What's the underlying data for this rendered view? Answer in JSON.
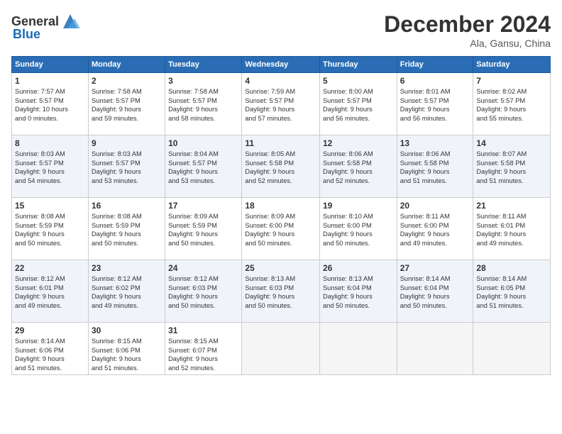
{
  "header": {
    "logo_general": "General",
    "logo_blue": "Blue",
    "month_title": "December 2024",
    "location": "Ala, Gansu, China"
  },
  "days_of_week": [
    "Sunday",
    "Monday",
    "Tuesday",
    "Wednesday",
    "Thursday",
    "Friday",
    "Saturday"
  ],
  "weeks": [
    [
      {
        "day": "1",
        "info": "Sunrise: 7:57 AM\nSunset: 5:57 PM\nDaylight: 10 hours\nand 0 minutes."
      },
      {
        "day": "2",
        "info": "Sunrise: 7:58 AM\nSunset: 5:57 PM\nDaylight: 9 hours\nand 59 minutes."
      },
      {
        "day": "3",
        "info": "Sunrise: 7:58 AM\nSunset: 5:57 PM\nDaylight: 9 hours\nand 58 minutes."
      },
      {
        "day": "4",
        "info": "Sunrise: 7:59 AM\nSunset: 5:57 PM\nDaylight: 9 hours\nand 57 minutes."
      },
      {
        "day": "5",
        "info": "Sunrise: 8:00 AM\nSunset: 5:57 PM\nDaylight: 9 hours\nand 56 minutes."
      },
      {
        "day": "6",
        "info": "Sunrise: 8:01 AM\nSunset: 5:57 PM\nDaylight: 9 hours\nand 56 minutes."
      },
      {
        "day": "7",
        "info": "Sunrise: 8:02 AM\nSunset: 5:57 PM\nDaylight: 9 hours\nand 55 minutes."
      }
    ],
    [
      {
        "day": "8",
        "info": "Sunrise: 8:03 AM\nSunset: 5:57 PM\nDaylight: 9 hours\nand 54 minutes."
      },
      {
        "day": "9",
        "info": "Sunrise: 8:03 AM\nSunset: 5:57 PM\nDaylight: 9 hours\nand 53 minutes."
      },
      {
        "day": "10",
        "info": "Sunrise: 8:04 AM\nSunset: 5:57 PM\nDaylight: 9 hours\nand 53 minutes."
      },
      {
        "day": "11",
        "info": "Sunrise: 8:05 AM\nSunset: 5:58 PM\nDaylight: 9 hours\nand 52 minutes."
      },
      {
        "day": "12",
        "info": "Sunrise: 8:06 AM\nSunset: 5:58 PM\nDaylight: 9 hours\nand 52 minutes."
      },
      {
        "day": "13",
        "info": "Sunrise: 8:06 AM\nSunset: 5:58 PM\nDaylight: 9 hours\nand 51 minutes."
      },
      {
        "day": "14",
        "info": "Sunrise: 8:07 AM\nSunset: 5:58 PM\nDaylight: 9 hours\nand 51 minutes."
      }
    ],
    [
      {
        "day": "15",
        "info": "Sunrise: 8:08 AM\nSunset: 5:59 PM\nDaylight: 9 hours\nand 50 minutes."
      },
      {
        "day": "16",
        "info": "Sunrise: 8:08 AM\nSunset: 5:59 PM\nDaylight: 9 hours\nand 50 minutes."
      },
      {
        "day": "17",
        "info": "Sunrise: 8:09 AM\nSunset: 5:59 PM\nDaylight: 9 hours\nand 50 minutes."
      },
      {
        "day": "18",
        "info": "Sunrise: 8:09 AM\nSunset: 6:00 PM\nDaylight: 9 hours\nand 50 minutes."
      },
      {
        "day": "19",
        "info": "Sunrise: 8:10 AM\nSunset: 6:00 PM\nDaylight: 9 hours\nand 50 minutes."
      },
      {
        "day": "20",
        "info": "Sunrise: 8:11 AM\nSunset: 6:00 PM\nDaylight: 9 hours\nand 49 minutes."
      },
      {
        "day": "21",
        "info": "Sunrise: 8:11 AM\nSunset: 6:01 PM\nDaylight: 9 hours\nand 49 minutes."
      }
    ],
    [
      {
        "day": "22",
        "info": "Sunrise: 8:12 AM\nSunset: 6:01 PM\nDaylight: 9 hours\nand 49 minutes."
      },
      {
        "day": "23",
        "info": "Sunrise: 8:12 AM\nSunset: 6:02 PM\nDaylight: 9 hours\nand 49 minutes."
      },
      {
        "day": "24",
        "info": "Sunrise: 8:12 AM\nSunset: 6:03 PM\nDaylight: 9 hours\nand 50 minutes."
      },
      {
        "day": "25",
        "info": "Sunrise: 8:13 AM\nSunset: 6:03 PM\nDaylight: 9 hours\nand 50 minutes."
      },
      {
        "day": "26",
        "info": "Sunrise: 8:13 AM\nSunset: 6:04 PM\nDaylight: 9 hours\nand 50 minutes."
      },
      {
        "day": "27",
        "info": "Sunrise: 8:14 AM\nSunset: 6:04 PM\nDaylight: 9 hours\nand 50 minutes."
      },
      {
        "day": "28",
        "info": "Sunrise: 8:14 AM\nSunset: 6:05 PM\nDaylight: 9 hours\nand 51 minutes."
      }
    ],
    [
      {
        "day": "29",
        "info": "Sunrise: 8:14 AM\nSunset: 6:06 PM\nDaylight: 9 hours\nand 51 minutes."
      },
      {
        "day": "30",
        "info": "Sunrise: 8:15 AM\nSunset: 6:06 PM\nDaylight: 9 hours\nand 51 minutes."
      },
      {
        "day": "31",
        "info": "Sunrise: 8:15 AM\nSunset: 6:07 PM\nDaylight: 9 hours\nand 52 minutes."
      },
      {
        "day": "",
        "info": ""
      },
      {
        "day": "",
        "info": ""
      },
      {
        "day": "",
        "info": ""
      },
      {
        "day": "",
        "info": ""
      }
    ]
  ]
}
